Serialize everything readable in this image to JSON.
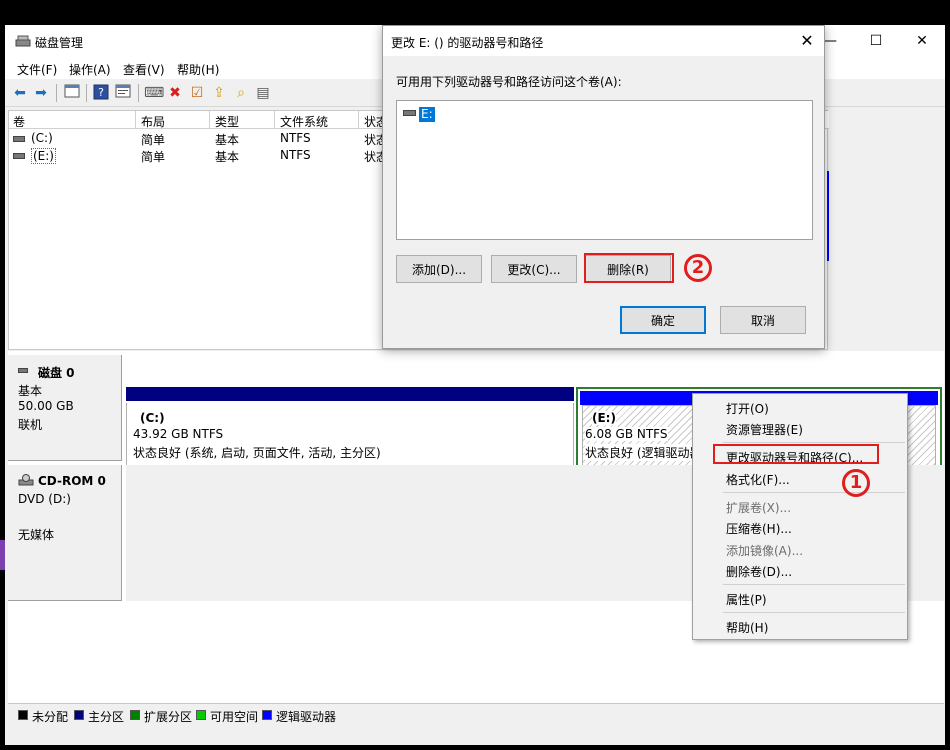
{
  "app": {
    "title": "磁盘管理",
    "window_buttons": {
      "minimize": "—",
      "maximize": "☐",
      "close": "✕"
    }
  },
  "menu": [
    "文件(F)",
    "操作(A)",
    "查看(V)",
    "帮助(H)"
  ],
  "toolbar_icons": [
    "back-icon",
    "forward-icon",
    "console-icon",
    "help-icon",
    "properties-icon",
    "connect-icon",
    "delete-icon",
    "check-icon",
    "export-icon",
    "search-icon",
    "list-icon"
  ],
  "volume_list": {
    "columns": [
      "卷",
      "布局",
      "类型",
      "文件系统",
      "状态"
    ],
    "rows": [
      {
        "volume": "(C:)",
        "layout": "简单",
        "type": "基本",
        "fs": "NTFS",
        "status": "状态"
      },
      {
        "volume": "(E:)",
        "layout": "简单",
        "type": "基本",
        "fs": "NTFS",
        "status": "状态"
      }
    ]
  },
  "disk0": {
    "name": "磁盘 0",
    "type": "基本",
    "size": "50.00 GB",
    "state": "联机",
    "partitions": [
      {
        "label": "(C:)",
        "size": "43.92 GB NTFS",
        "status": "状态良好 (系统, 启动, 页面文件, 活动, 主分区)"
      },
      {
        "label": "(E:)",
        "size": "6.08 GB NTFS",
        "status": "状态良好 (逻辑驱动器"
      }
    ]
  },
  "cdrom0": {
    "name": "CD-ROM 0",
    "drive": "DVD (D:)",
    "media": "无媒体"
  },
  "legend": [
    {
      "label": "未分配",
      "color": "#000000"
    },
    {
      "label": "主分区",
      "color": "#000080"
    },
    {
      "label": "扩展分区",
      "color": "#008000"
    },
    {
      "label": "可用空间",
      "color": "#00cc00"
    },
    {
      "label": "逻辑驱动器",
      "color": "#0000ff"
    }
  ],
  "dialog": {
    "title": "更改 E: () 的驱动器号和路径",
    "description": "可用用下列驱动器号和路径访问这个卷(A):",
    "paths": [
      "E:"
    ],
    "add": "添加(D)...",
    "change": "更改(C)...",
    "remove": "删除(R)",
    "ok": "确定",
    "cancel": "取消",
    "close": "✕"
  },
  "context_menu": {
    "open": "打开(O)",
    "explorer": "资源管理器(E)",
    "change_letter": "更改驱动器号和路径(C)...",
    "format": "格式化(F)...",
    "extend": "扩展卷(X)...",
    "shrink": "压缩卷(H)...",
    "mirror": "添加镜像(A)...",
    "delete": "删除卷(D)...",
    "properties": "属性(P)",
    "help": "帮助(H)"
  },
  "annotations": {
    "one": "1",
    "two": "2"
  },
  "colors": {
    "primary_partition": "#000080",
    "logical_drive": "#0000ff",
    "selection_border": "#2e7d32",
    "highlight_red": "#e01e1e",
    "selection_blue": "#0078d7"
  }
}
